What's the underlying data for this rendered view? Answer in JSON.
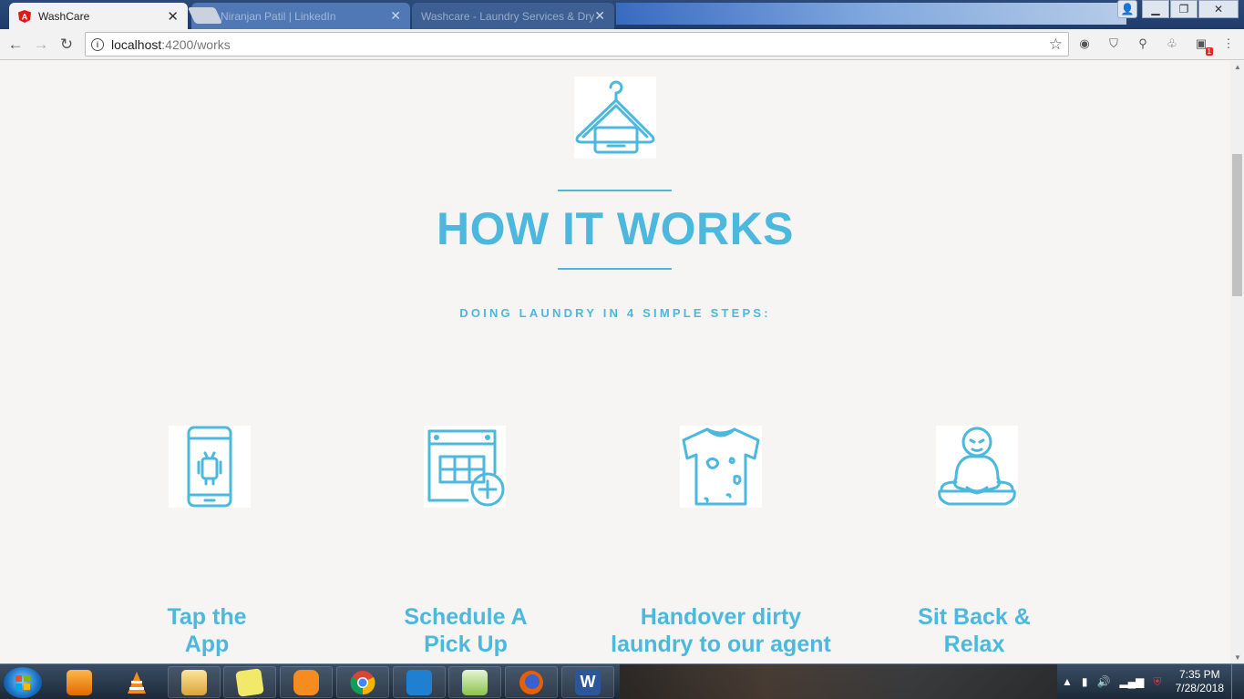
{
  "browser": {
    "active_tab": {
      "title": "WashCare",
      "icon": "angular-icon"
    },
    "background_tabs": [
      {
        "title": "Niranjan Patil | LinkedIn"
      },
      {
        "title": "Washcare - Laundry Services & Dry"
      }
    ],
    "address": {
      "host": "localhost",
      "rest": ":4200/works"
    },
    "extensions": [
      "globe-icon",
      "shield-icon",
      "search-icon",
      "leaf-icon",
      "note-icon"
    ],
    "extension_badge": "1"
  },
  "page": {
    "hero_icon": "hanger-icon",
    "title": "HOW IT WORKS",
    "subtitle": "DOING LAUNDRY IN 4 SIMPLE STEPS:",
    "accent_color": "#4cb8dd",
    "steps": [
      {
        "icon": "smartphone-icon",
        "title": "Tap the\nApp"
      },
      {
        "icon": "calendar-add-icon",
        "title": "Schedule A\nPick Up"
      },
      {
        "icon": "dirty-shirt-icon",
        "title": "Handover dirty\nlaundry to our agent"
      },
      {
        "icon": "meditation-icon",
        "title": "Sit Back &\nRelax"
      }
    ]
  },
  "taskbar": {
    "apps": [
      "media-player-icon",
      "vlc-icon",
      "explorer-icon",
      "sticky-notes-icon",
      "uc-browser-icon",
      "chrome-icon",
      "vscode-icon",
      "notepadpp-icon",
      "firefox-icon",
      "word-icon"
    ],
    "time": "7:35 PM",
    "date": "7/28/2018"
  }
}
